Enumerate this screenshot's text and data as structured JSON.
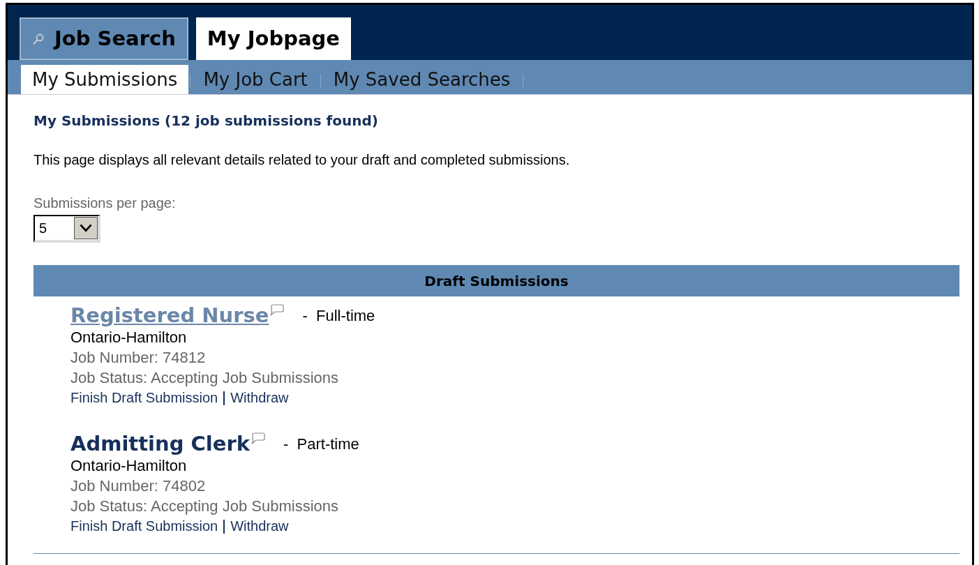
{
  "main_tabs": [
    {
      "label": "Job Search",
      "icon": true,
      "selected": false
    },
    {
      "label": "My Jobpage",
      "icon": false,
      "selected": true
    }
  ],
  "sub_tabs": [
    {
      "label": "My Submissions",
      "selected": true
    },
    {
      "label": "My Job Cart",
      "selected": false
    },
    {
      "label": "My Saved Searches",
      "selected": false
    }
  ],
  "heading": "My Submissions (12 job submissions found)",
  "description": "This page displays all relevant details related to your draft and completed submissions.",
  "per_page": {
    "label": "Submissions per page:",
    "value": "5"
  },
  "section": {
    "title": "Draft Submissions",
    "jobs": [
      {
        "title": "Registered Nurse",
        "visited": true,
        "type": "-  Full-time",
        "location": "Ontario-Hamilton",
        "number": "Job Number: 74812",
        "status": "Job Status: Accepting Job Submissions",
        "actions": [
          "Finish Draft Submission",
          "Withdraw"
        ]
      },
      {
        "title": "Admitting Clerk",
        "visited": false,
        "type": "-  Part-time",
        "location": "Ontario-Hamilton",
        "number": "Job Number: 74802",
        "status": "Job Status: Accepting Job Submissions",
        "actions": [
          "Finish Draft Submission",
          "Withdraw"
        ]
      }
    ]
  }
}
